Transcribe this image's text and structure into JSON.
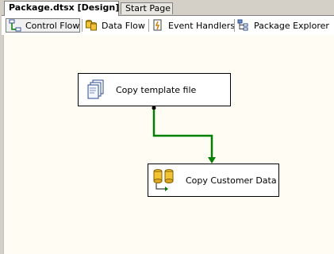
{
  "doc_tabs": [
    {
      "label": "Package.dtsx [Design]",
      "active": true
    },
    {
      "label": "Start Page",
      "active": false
    }
  ],
  "sub_tabs": [
    {
      "label": "Control Flow",
      "icon": "control-flow-icon",
      "active": true
    },
    {
      "label": "Data Flow",
      "icon": "data-flow-icon",
      "active": false
    },
    {
      "label": "Event Handlers",
      "icon": "event-handlers-icon",
      "active": false
    },
    {
      "label": "Package Explorer",
      "icon": "package-explorer-icon",
      "active": false
    }
  ],
  "tasks": [
    {
      "label": "Copy template file",
      "icon": "file-system-task-icon"
    },
    {
      "label": "Copy Customer Data",
      "icon": "data-flow-task-icon"
    }
  ],
  "connector": {
    "from": "Copy template file",
    "to": "Copy Customer Data",
    "color": "#008000",
    "constraint": "success"
  },
  "colors": {
    "canvas": "#fefcf3",
    "chrome": "#d4d0c8",
    "success": "#008000"
  }
}
